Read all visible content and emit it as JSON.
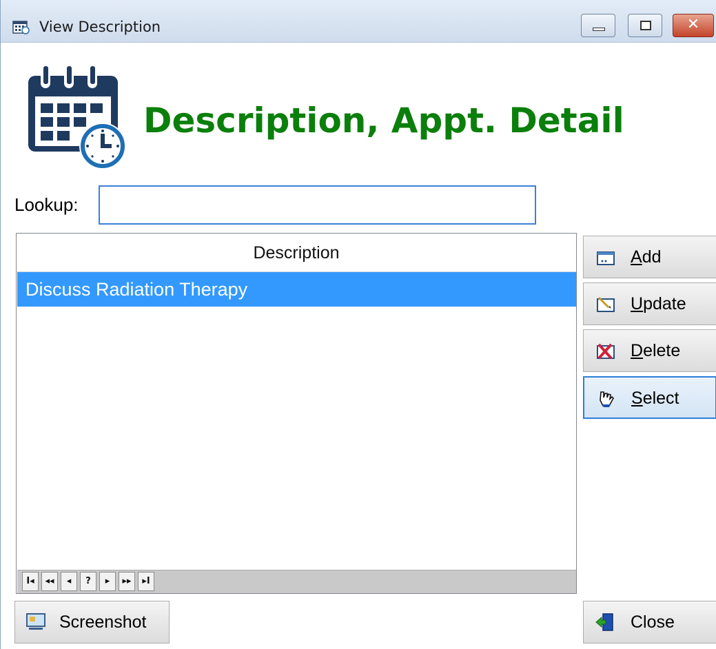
{
  "window": {
    "title": "View Description",
    "title_icon": "calendar-small-icon",
    "controls": {
      "minimize": "minimize",
      "maximize": "maximize",
      "close": "✕"
    }
  },
  "header": {
    "icon": "calendar-clock-icon",
    "title": "Description, Appt. Detail",
    "title_color": "#0b7f0b"
  },
  "lookup": {
    "label": "Lookup:",
    "value": "",
    "placeholder": ""
  },
  "grid": {
    "column_header": "Description",
    "rows": [
      {
        "description": "Discuss Radiation Therapy",
        "selected": true
      }
    ],
    "selection_color": "#3399ff",
    "navigator": [
      "I◂",
      "◂◂",
      "◂",
      "?",
      "▸",
      "▸▸",
      "▸I"
    ]
  },
  "actions": {
    "add": {
      "prefix": "",
      "hot": "A",
      "rest": "dd",
      "icon": "add-icon"
    },
    "update": {
      "prefix": "",
      "hot": "U",
      "rest": "pdate",
      "icon": "update-icon"
    },
    "delete": {
      "prefix": "",
      "hot": "D",
      "rest": "elete",
      "icon": "delete-icon"
    },
    "select": {
      "prefix": "",
      "hot": "S",
      "rest": "elect",
      "icon": "hand-pointer-icon"
    }
  },
  "footer": {
    "screenshot": {
      "label": "Screenshot",
      "icon": "screenshot-icon"
    },
    "close": {
      "label": "Close",
      "icon": "exit-door-icon"
    }
  }
}
